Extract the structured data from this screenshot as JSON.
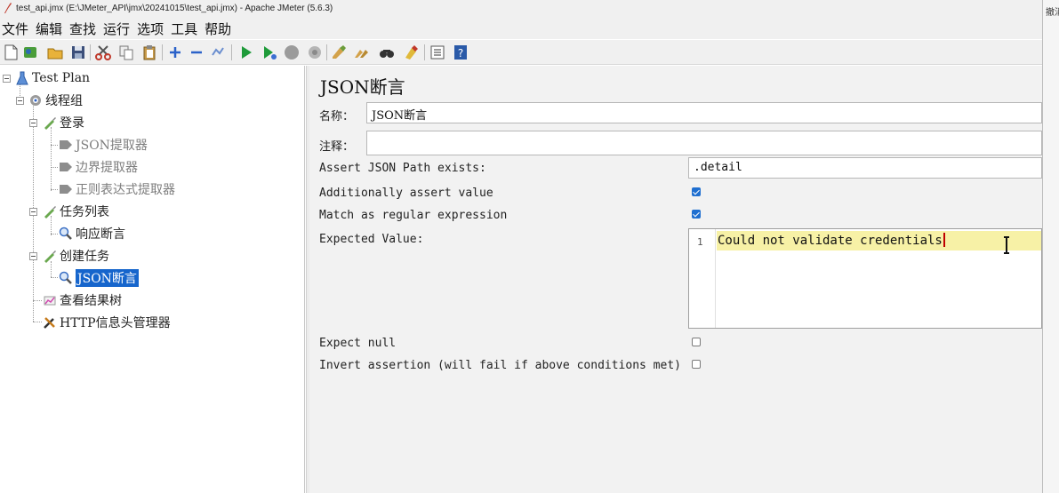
{
  "window": {
    "title": "test_api.jmx (E:\\JMeter_API\\jmx\\20241015\\test_api.jmx) - Apache JMeter (5.6.3)"
  },
  "menu": [
    "文件",
    "编辑",
    "查找",
    "运行",
    "选项",
    "工具",
    "帮助"
  ],
  "toolbar_icons": [
    "new-icon",
    "templates-icon",
    "open-icon",
    "save-icon",
    "cut-icon",
    "copy-icon",
    "paste-icon",
    "expand-icon",
    "collapse-icon",
    "toggle-icon",
    "start-icon",
    "start-no-pause-icon",
    "stop-icon",
    "shutdown-icon",
    "clear-icon",
    "clear-all-icon",
    "search-icon",
    "reset-search-icon",
    "function-helper-icon",
    "help-icon"
  ],
  "tree": {
    "nodes": [
      {
        "label": "Test Plan",
        "icon": "test-plan-icon"
      },
      {
        "label": "线程组",
        "icon": "thread-group-icon"
      },
      {
        "label": "登录",
        "icon": "sampler-icon"
      },
      {
        "label": "JSON提取器",
        "icon": "post-processor-icon"
      },
      {
        "label": "边界提取器",
        "icon": "post-processor-icon"
      },
      {
        "label": "正则表达式提取器",
        "icon": "post-processor-icon"
      },
      {
        "label": "任务列表",
        "icon": "sampler-icon"
      },
      {
        "label": "响应断言",
        "icon": "assertion-icon"
      },
      {
        "label": "创建任务",
        "icon": "sampler-icon"
      },
      {
        "label": "JSON断言",
        "icon": "assertion-icon"
      },
      {
        "label": "查看结果树",
        "icon": "listener-icon"
      },
      {
        "label": "HTTP信息头管理器",
        "icon": "config-element-icon"
      }
    ]
  },
  "panel": {
    "heading": "JSON断言",
    "name_label": "名称：",
    "name_value": "JSON断言",
    "comment_label": "注释：",
    "comment_value": "",
    "assert_path_label": "Assert JSON Path exists:",
    "assert_path_value": ".detail",
    "additionally_label": "Additionally assert value",
    "additionally_checked": true,
    "regex_label": "Match as regular expression",
    "regex_checked": true,
    "expected_label": "Expected Value:",
    "expected_line_number": "1",
    "expected_value": "Could not validate credentials",
    "expect_null_label": "Expect null",
    "expect_null_checked": false,
    "invert_label": "Invert assertion (will fail if above conditions met)",
    "invert_checked": false
  },
  "right_edge": {
    "text": "撤消"
  }
}
